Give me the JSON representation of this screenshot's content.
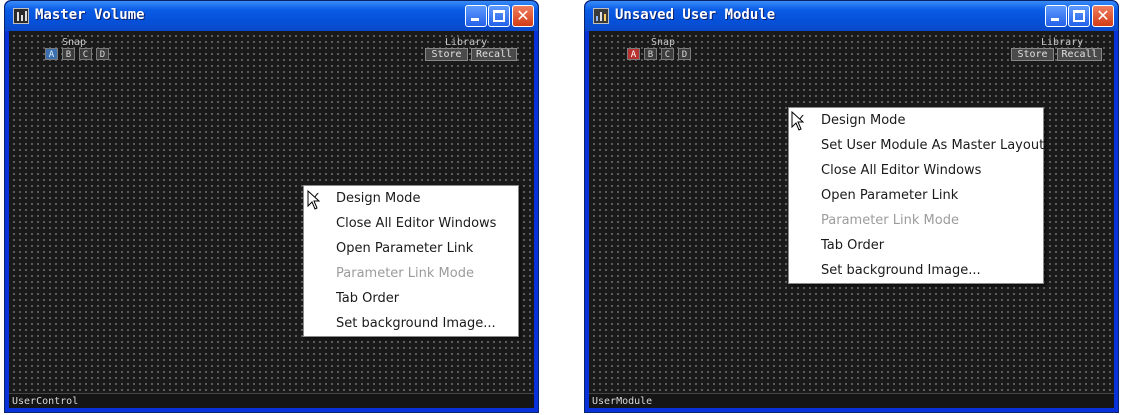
{
  "windows": [
    {
      "title": "Master Volume",
      "status": "UserControl",
      "snap": {
        "label": "Snap",
        "buttons": [
          "A",
          "B",
          "C",
          "D"
        ],
        "active_color": "#3b6fb0"
      },
      "library": {
        "label": "Library",
        "store": "Store",
        "recall": "Recall"
      },
      "menu_items": [
        {
          "label": "Design Mode",
          "checked": true,
          "enabled": true
        },
        {
          "label": "Close All Editor Windows",
          "enabled": true
        },
        {
          "label": "Open Parameter Link",
          "enabled": true
        },
        {
          "label": "Parameter Link Mode",
          "enabled": false
        },
        {
          "label": "Tab Order",
          "enabled": true
        },
        {
          "label": "Set background Image...",
          "enabled": true
        }
      ]
    },
    {
      "title": "Unsaved User Module",
      "status": "UserModule",
      "snap": {
        "label": "Snap",
        "buttons": [
          "A",
          "B",
          "C",
          "D"
        ],
        "active_color": "#b8322f"
      },
      "library": {
        "label": "Library",
        "store": "Store",
        "recall": "Recall"
      },
      "menu_items": [
        {
          "label": "Design Mode",
          "checked": true,
          "enabled": true
        },
        {
          "label": "Set User Module As Master Layout",
          "enabled": true
        },
        {
          "label": "Close All Editor Windows",
          "enabled": true
        },
        {
          "label": "Open Parameter Link",
          "enabled": true
        },
        {
          "label": "Parameter Link Mode",
          "enabled": false
        },
        {
          "label": "Tab Order",
          "enabled": true
        },
        {
          "label": "Set background Image...",
          "enabled": true
        }
      ]
    }
  ],
  "icons": {
    "title_left": "fader-app-icon",
    "title_right": "module-app-icon",
    "minimize": "minimize-icon",
    "maximize": "maximize-icon",
    "close": "close-icon",
    "check": "checkmark-icon",
    "cursor": "mouse-pointer-icon"
  }
}
